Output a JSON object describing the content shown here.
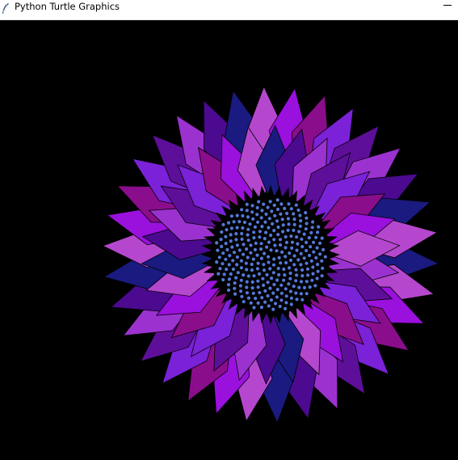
{
  "window": {
    "title": "Python Turtle Graphics",
    "minimize_icon": "minimize-icon",
    "app_icon": "feather-icon"
  },
  "canvas": {
    "background": "#000000",
    "drawing": "sunflower",
    "petal_colors": [
      "#1a1a80",
      "#8a0d8c",
      "#9b32cf",
      "#b547ce",
      "#7b21d8",
      "#4b0a8f",
      "#9a10dd",
      "#5e0f9a"
    ],
    "seed_color": "#5478d8",
    "center_color": "#000000"
  }
}
